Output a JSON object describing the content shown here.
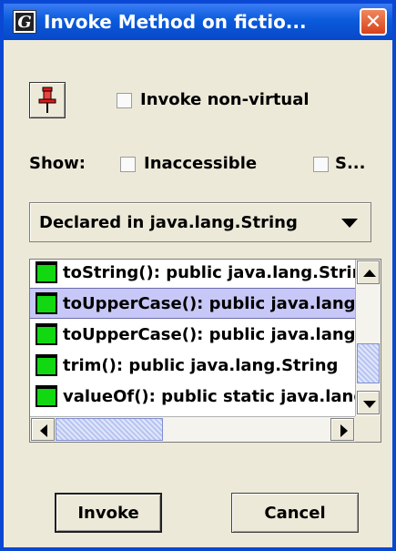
{
  "window": {
    "title": "Invoke Method on fictio...",
    "title_icon_letter": "G",
    "close_glyph": "✕"
  },
  "options": {
    "pin_icon": "pin-icon",
    "invoke_nonvirtual_label": "Invoke non-virtual",
    "show_label": "Show:",
    "inaccessible_label": "Inaccessible",
    "static_label": "S..."
  },
  "filter": {
    "selected": "Declared in java.lang.String"
  },
  "methods": [
    {
      "text": "toString():  public java.lang.String",
      "selected": false
    },
    {
      "text": "toUpperCase():  public java.lang.String",
      "selected": true
    },
    {
      "text": "toUpperCase():  public java.lang.String",
      "selected": false
    },
    {
      "text": "trim():  public java.lang.String",
      "selected": false
    },
    {
      "text": "valueOf():  public static java.lang.String",
      "selected": false
    }
  ],
  "buttons": {
    "invoke": "Invoke",
    "cancel": "Cancel"
  },
  "colors": {
    "title_bar": "#0a5bdc",
    "selection": "#c8c8f8",
    "method_icon": "#11d811",
    "close_button": "#d8401c"
  }
}
